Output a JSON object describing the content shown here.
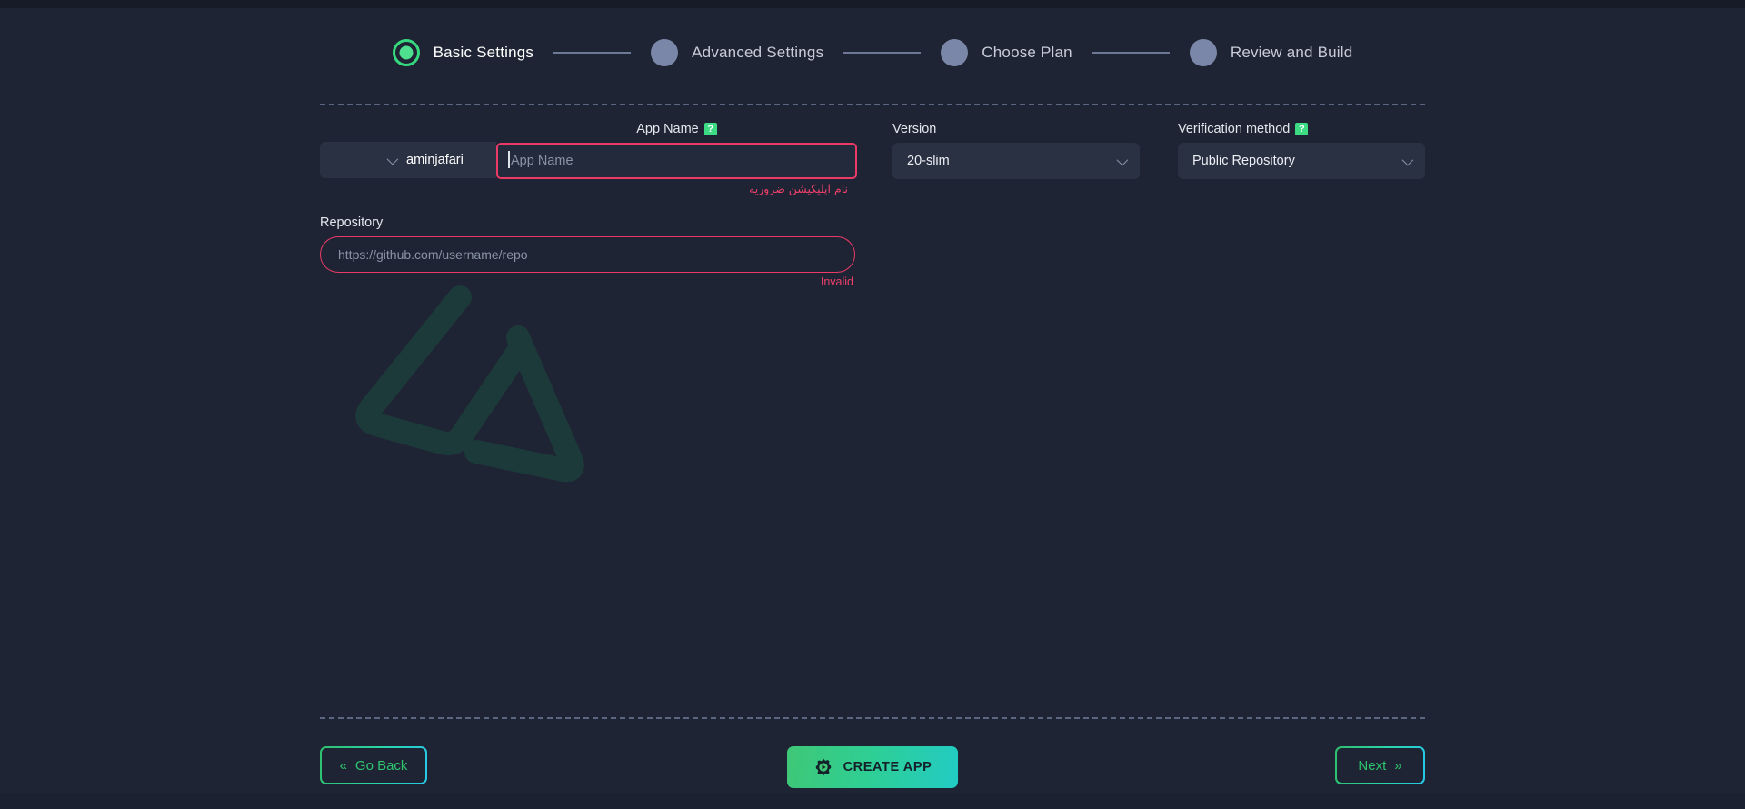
{
  "stepper": {
    "steps": [
      {
        "label": "Basic Settings",
        "state": "active"
      },
      {
        "label": "Advanced Settings",
        "state": "inactive"
      },
      {
        "label": "Choose Plan",
        "state": "inactive"
      },
      {
        "label": "Review and Build",
        "state": "inactive"
      }
    ]
  },
  "form": {
    "owner": {
      "value": "aminjafari",
      "chevron_icon": "chevron-down-icon"
    },
    "app_name": {
      "label": "App Name",
      "help_icon": "question-mark-icon",
      "help_glyph": "?",
      "value": "",
      "placeholder": "App Name",
      "error": "نام اپلیکیشن ضروریه"
    },
    "version": {
      "label": "Version",
      "value": "20-slim",
      "chevron_icon": "chevron-down-icon"
    },
    "verification_method": {
      "label": "Verification method",
      "help_icon": "question-mark-icon",
      "help_glyph": "?",
      "value": "Public Repository",
      "chevron_icon": "chevron-down-icon"
    },
    "repository": {
      "label": "Repository",
      "value": "",
      "placeholder": "https://github.com/username/repo",
      "error": "Invalid"
    }
  },
  "footer": {
    "go_back": {
      "label": "Go Back",
      "chevrons": "«"
    },
    "create_app": {
      "label": "CREATE APP",
      "icon": "gear-icon"
    },
    "next": {
      "label": "Next",
      "chevrons": "»"
    }
  },
  "watermark": {
    "icon": "brand-logo-icon"
  },
  "colors": {
    "background": "#1e2433",
    "panel": "#2a3143",
    "accent_green": "#3ddc84",
    "accent_cyan": "#22cbc4",
    "error_pink": "#ec3a67",
    "step_inactive": "#7b87a8"
  }
}
